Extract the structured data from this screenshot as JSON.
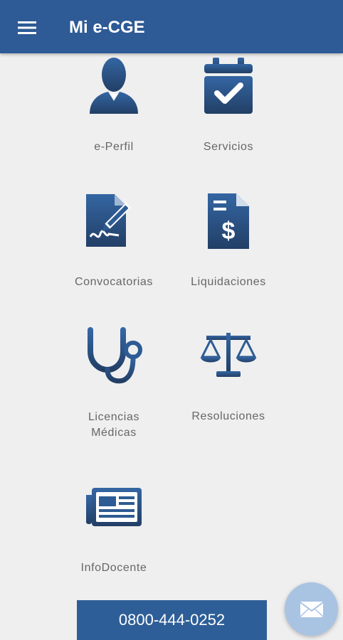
{
  "app": {
    "title": "Mi e-CGE",
    "brand_color": "#2e5a95",
    "icon_color": "#2d5b93"
  },
  "tiles": [
    {
      "label": "e-Perfil",
      "icon": "user-profile-icon"
    },
    {
      "label": "Servicios",
      "icon": "calendar-check-icon"
    },
    {
      "label": "Convocatorias",
      "icon": "document-signature-icon"
    },
    {
      "label": "Liquidaciones",
      "icon": "invoice-dollar-icon"
    },
    {
      "label": "Licencias\nMédicas",
      "icon": "stethoscope-icon"
    },
    {
      "label": "Resoluciones",
      "icon": "balance-scale-icon"
    },
    {
      "label": "InfoDocente",
      "icon": "newspaper-icon"
    }
  ],
  "contact": {
    "phone": "0800-444-0252",
    "fab_icon": "envelope-icon"
  }
}
